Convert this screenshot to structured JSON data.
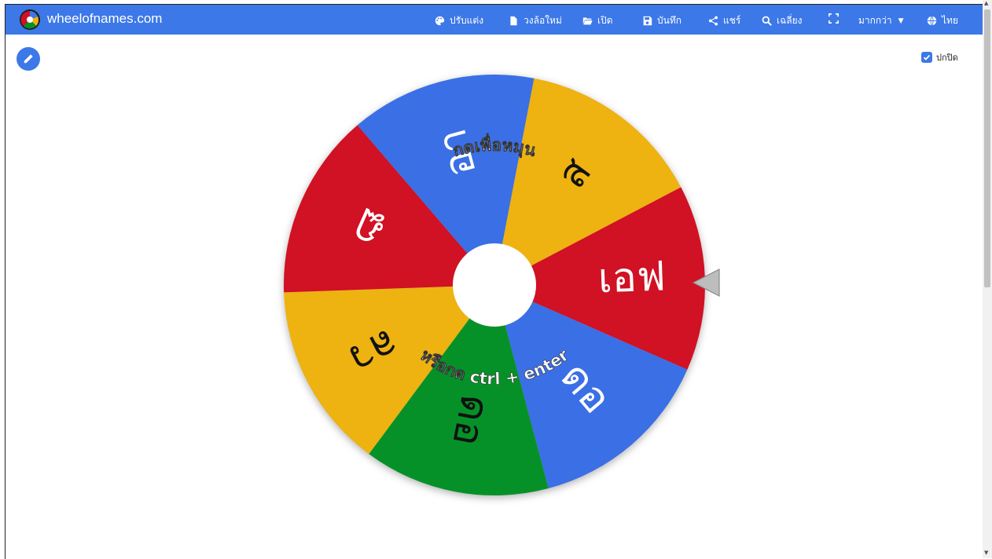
{
  "header": {
    "site_name": "wheelofnames.com",
    "menu": [
      {
        "label": "ปรับแต่ง",
        "icon": "palette-icon"
      },
      {
        "label": "วงล้อใหม่",
        "icon": "new-file-icon"
      },
      {
        "label": "เปิด",
        "icon": "folder-open-icon"
      },
      {
        "label": "บันทึก",
        "icon": "save-icon"
      },
      {
        "label": "แชร์",
        "icon": "share-icon"
      },
      {
        "label": "เฉลี่ยง",
        "icon": "search-icon"
      },
      {
        "label": "",
        "icon": "fullscreen-icon"
      },
      {
        "label": "มากกว่า",
        "icon": "chevron-down-icon"
      },
      {
        "label": "ไทย",
        "icon": "globe-icon"
      }
    ]
  },
  "controls": {
    "mute_label": "ปกปิด",
    "mute_checked": true
  },
  "wheel": {
    "segments": [
      {
        "label": "เอฟ",
        "color": "#d11124"
      },
      {
        "label": "ดอ",
        "color": "#3b6fe5"
      },
      {
        "label": "ดอ",
        "color": "#069128"
      },
      {
        "label": "ลว",
        "color": "#eeb211"
      },
      {
        "label": "ฏ",
        "color": "#d11124"
      },
      {
        "label": "อา",
        "color": "#3b6fe5"
      },
      {
        "label": "ส",
        "color": "#eeb211"
      }
    ],
    "top_caption": "กดเพื่อหมุน",
    "bottom_caption": "หรือกด ctrl + enter"
  },
  "colors": {
    "brand": "#3c78e8",
    "red": "#d11124",
    "blue": "#3b6fe5",
    "green": "#069128",
    "yellow": "#eeb211"
  }
}
